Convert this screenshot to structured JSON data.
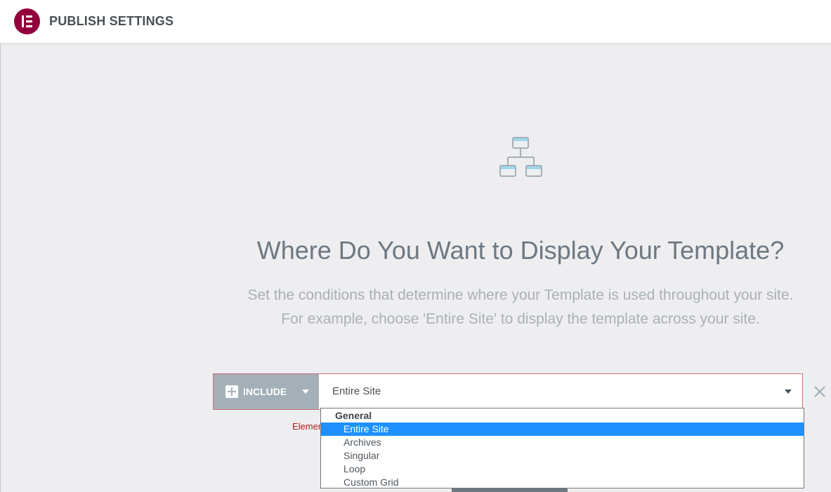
{
  "header": {
    "title": "PUBLISH SETTINGS",
    "logo_icon": "elementor-logo-icon",
    "logo_color": "#92003b"
  },
  "main": {
    "icon": "sitemap-icon",
    "heading": "Where Do You Want to Display Your Template?",
    "description_line1": "Set the conditions that determine where your Template is used throughout your site.",
    "description_line2": "For example, choose 'Entire Site' to display the template across your site."
  },
  "condition": {
    "include_label": "INCLUDE",
    "include_icon": "plus-square-icon",
    "selected_value": "Entire Site",
    "remove_icon": "close-icon",
    "error_text": "Elemen",
    "dropdown": {
      "group_label": "General",
      "options": [
        "Entire Site",
        "Archives",
        "Singular",
        "Loop",
        "Custom Grid"
      ],
      "selected_index": 0
    }
  },
  "colors": {
    "accent": "#92003b",
    "error": "#b01b1b",
    "highlight": "#1e90ff",
    "include_bg": "#a4afb7"
  }
}
